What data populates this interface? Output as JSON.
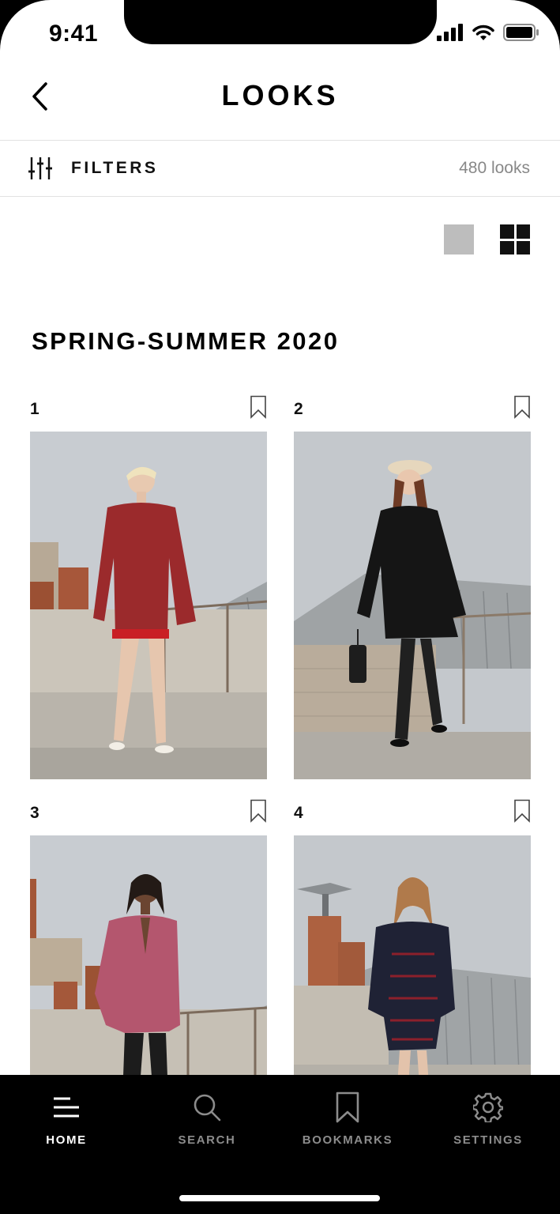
{
  "status_bar": {
    "time": "9:41"
  },
  "header": {
    "title": "LOOKS",
    "back_icon": "chevron-left-icon"
  },
  "filters": {
    "label": "FILTERS",
    "icon": "sliders-icon",
    "count": "480 looks"
  },
  "view_toggle": {
    "single_icon": "single-view-icon",
    "grid_icon": "grid-view-icon",
    "active": "grid"
  },
  "season": {
    "title": "SPRING-SUMMER 2020"
  },
  "looks": [
    {
      "number": "1",
      "bookmark_icon": "bookmark-icon",
      "outfit_color": "#9b2a2c",
      "trim_color": "#c91f25"
    },
    {
      "number": "2",
      "bookmark_icon": "bookmark-icon",
      "outfit_color": "#151515",
      "trim_color": "#2a2a2a"
    },
    {
      "number": "3",
      "bookmark_icon": "bookmark-icon",
      "outfit_color": "#b4566e",
      "trim_color": "#6a1b2c"
    },
    {
      "number": "4",
      "bookmark_icon": "bookmark-icon",
      "outfit_color": "#1f2235",
      "trim_color": "#a0202a"
    }
  ],
  "tabs": [
    {
      "label": "HOME",
      "icon": "menu-icon",
      "active": true
    },
    {
      "label": "SEARCH",
      "icon": "search-icon",
      "active": false
    },
    {
      "label": "BOOKMARKS",
      "icon": "bookmark-icon",
      "active": false
    },
    {
      "label": "SETTINGS",
      "icon": "gear-icon",
      "active": false
    }
  ],
  "colors": {
    "accent": "#000000",
    "muted": "#888888",
    "sky": "#c9cdd2"
  }
}
